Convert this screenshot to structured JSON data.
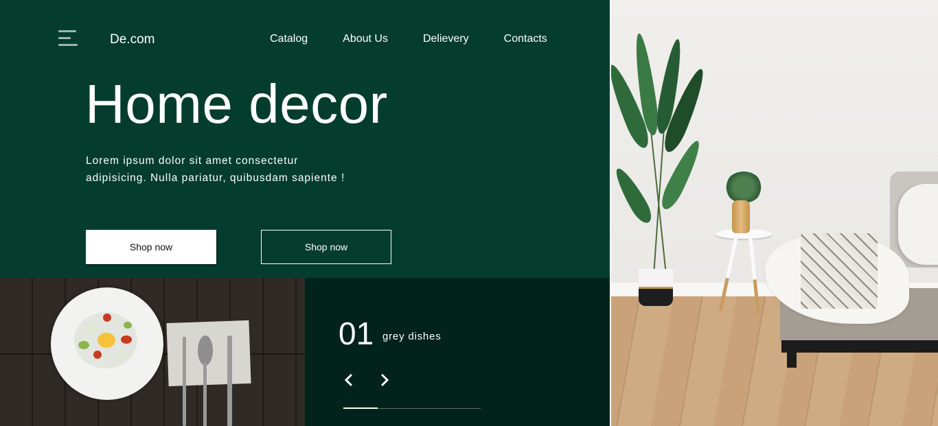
{
  "header": {
    "logo": "De.com",
    "nav": [
      "Catalog",
      "About Us",
      "Delievery",
      "Contacts"
    ]
  },
  "hero": {
    "title": "Home decor",
    "description_line1": "Lorem ipsum dolor sit amet consectetur",
    "description_line2": "adipisicing. Nulla pariatur, quibusdam sapiente !",
    "primary_button": "Shop now",
    "secondary_button": "Shop now"
  },
  "slider": {
    "number": "01",
    "label": "grey dishes",
    "progress": 0.25
  },
  "icons": {
    "menu": "menu-icon",
    "prev": "chevron-left-icon",
    "next": "chevron-right-icon"
  },
  "colors": {
    "hero_bg": "#043d2e",
    "slider_bg": "#01231b",
    "text": "#ffffff"
  }
}
